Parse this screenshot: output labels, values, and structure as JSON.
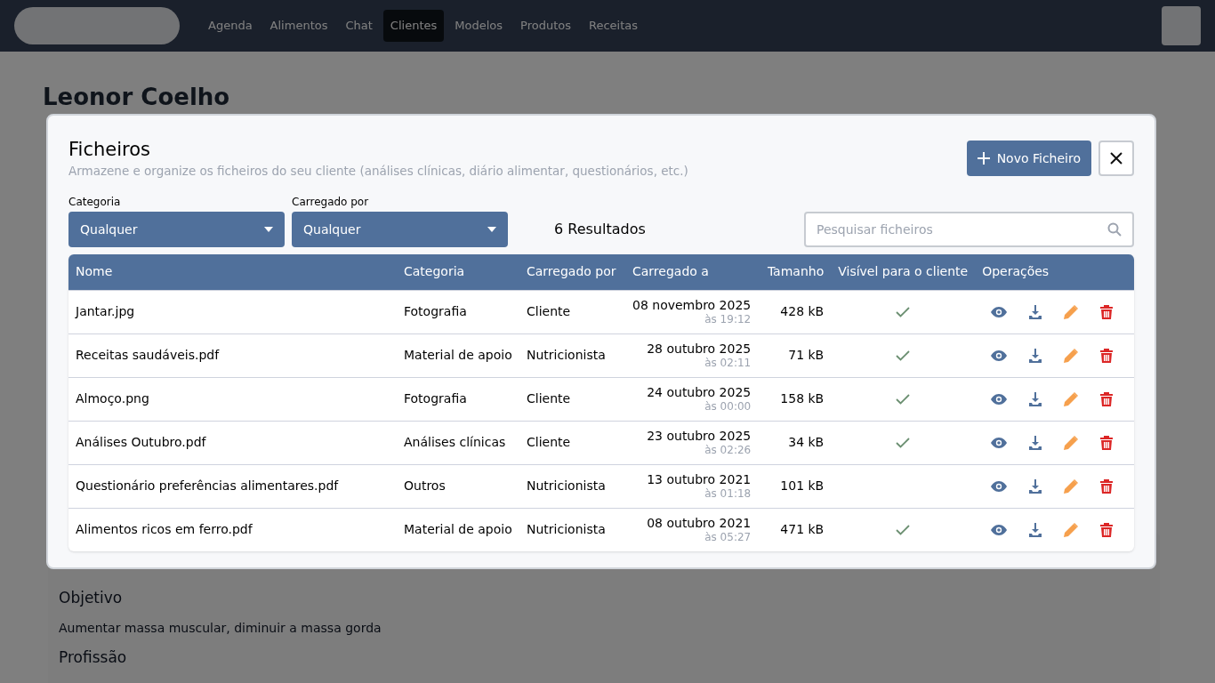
{
  "background": {
    "nav_items": [
      {
        "label": "Agenda",
        "selected": false
      },
      {
        "label": "Alimentos",
        "selected": false
      },
      {
        "label": "Chat",
        "selected": false
      },
      {
        "label": "Clientes",
        "selected": true
      },
      {
        "label": "Modelos",
        "selected": false
      },
      {
        "label": "Produtos",
        "selected": false
      },
      {
        "label": "Receitas",
        "selected": false
      }
    ],
    "client_name": "Leonor Coelho",
    "sections": [
      {
        "heading": "Objetivo",
        "text": "Aumentar massa muscular, diminuir a massa gorda"
      },
      {
        "heading": "Profissão"
      }
    ]
  },
  "dialog": {
    "title": "Ficheiros",
    "subtitle": "Armazene e organize os ficheiros do seu cliente (análises clínicas, diário alimentar, questionários, etc.)",
    "new_button": "Novo Ficheiro",
    "filters": [
      {
        "label": "Categoria",
        "value": "Qualquer"
      },
      {
        "label": "Carregado por",
        "value": "Qualquer"
      }
    ],
    "results": "6 Resultados",
    "search": {
      "placeholder": "Pesquisar ficheiros"
    },
    "columns": [
      "Nome",
      "Categoria",
      "Carregado por",
      "Carregado a",
      "Tamanho",
      "Visível para o cliente",
      "Operações"
    ],
    "rows": [
      {
        "name": "Jantar.jpg",
        "category": "Fotografia",
        "uploaded_by": "Cliente",
        "date": "08 novembro 2025",
        "time": "às 19:12",
        "size": "428 kB",
        "visible": true
      },
      {
        "name": "Receitas saudáveis.pdf",
        "category": "Material de apoio",
        "uploaded_by": "Nutricionista",
        "date": "28 outubro 2025",
        "time": "às 02:11",
        "size": "71 kB",
        "visible": true
      },
      {
        "name": "Almoço.png",
        "category": "Fotografia",
        "uploaded_by": "Cliente",
        "date": "24 outubro 2025",
        "time": "às 00:00",
        "size": "158 kB",
        "visible": true
      },
      {
        "name": "Análises Outubro.pdf",
        "category": "Análises clínicas",
        "uploaded_by": "Cliente",
        "date": "23 outubro 2025",
        "time": "às 02:26",
        "size": "34 kB",
        "visible": true
      },
      {
        "name": "Questionário preferências alimentares.pdf",
        "category": "Outros",
        "uploaded_by": "Nutricionista",
        "date": "13 outubro 2021",
        "time": "às 01:18",
        "size": "101 kB",
        "visible": false
      },
      {
        "name": "Alimentos ricos em ferro.pdf",
        "category": "Material de apoio",
        "uploaded_by": "Nutricionista",
        "date": "08 outubro 2021",
        "time": "às 05:27",
        "size": "471 kB",
        "visible": true
      }
    ]
  }
}
